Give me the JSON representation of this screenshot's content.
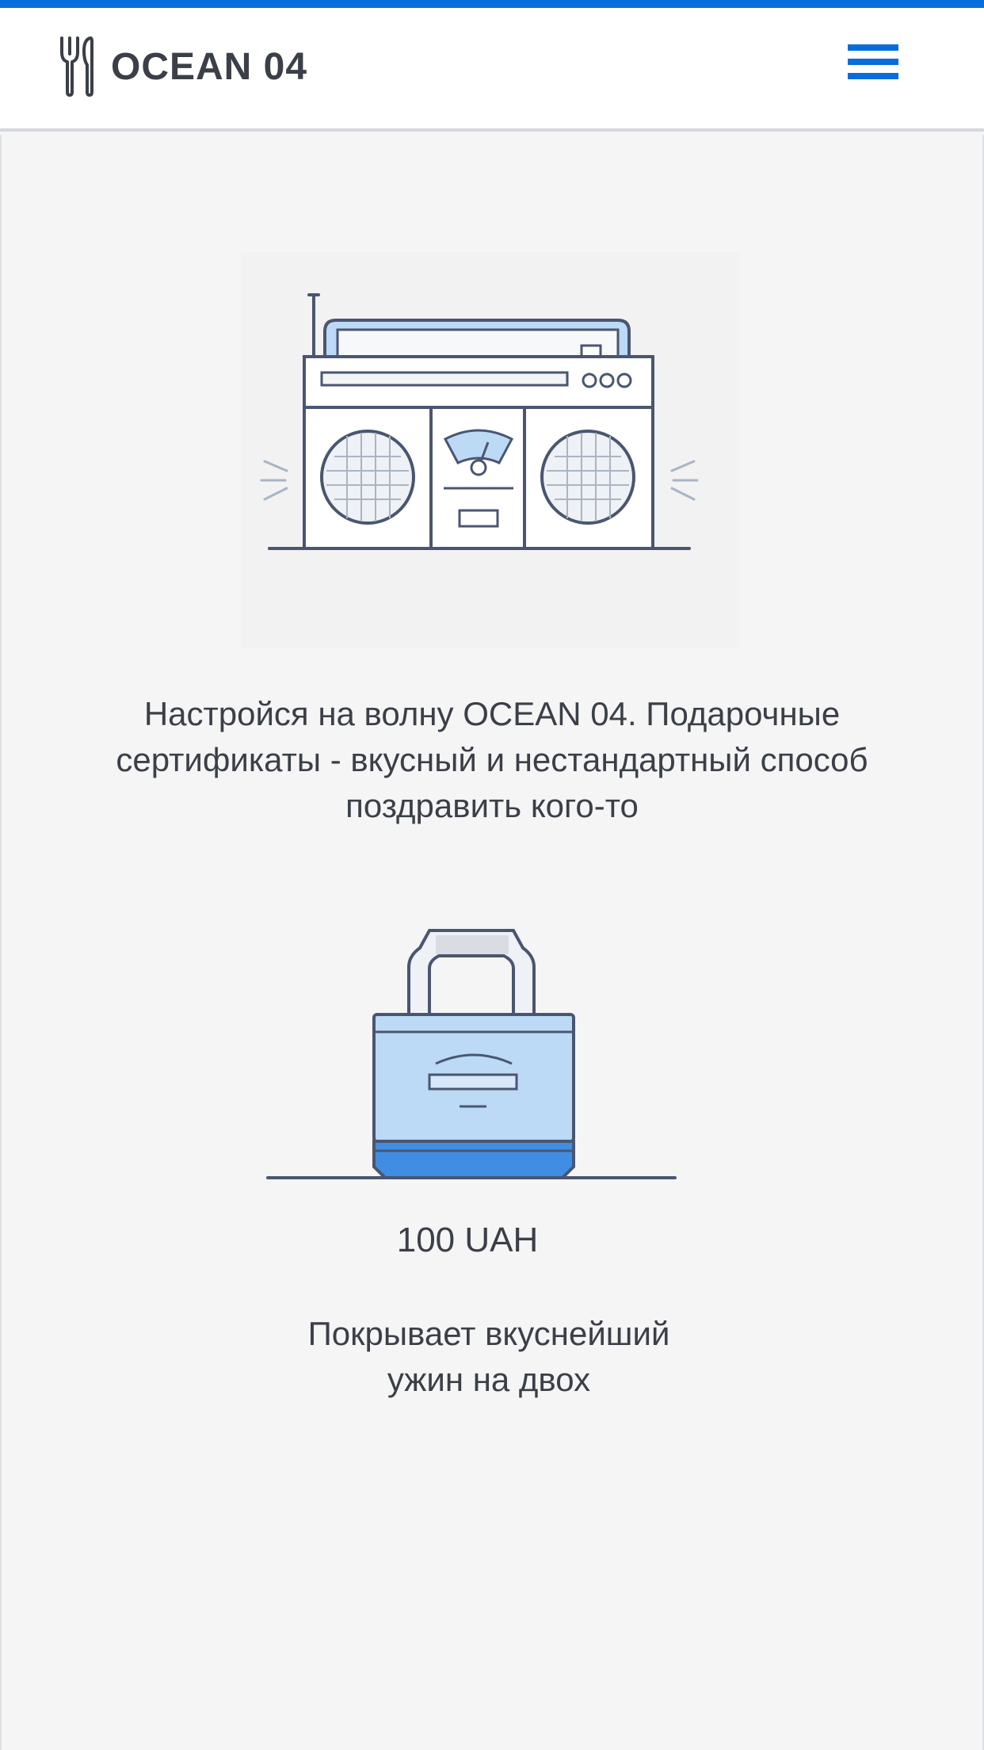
{
  "header": {
    "brand_name": "OCEAN 04",
    "logo_icon": "fork-knife-icon",
    "menu_icon": "hamburger-menu-icon",
    "accent_color": "#0a6ddc"
  },
  "hero": {
    "illustration": "boombox-illustration",
    "text": "Настройся на волну OCEAN 04. Подарочные сертификаты - вкусный и нестандартный способ поздравить кого-то"
  },
  "certificate": {
    "illustration": "shopping-bag-illustration",
    "price": "100 UAH",
    "description_line1": "Покрывает вкуснейший",
    "description_line2": "ужин на двох"
  }
}
